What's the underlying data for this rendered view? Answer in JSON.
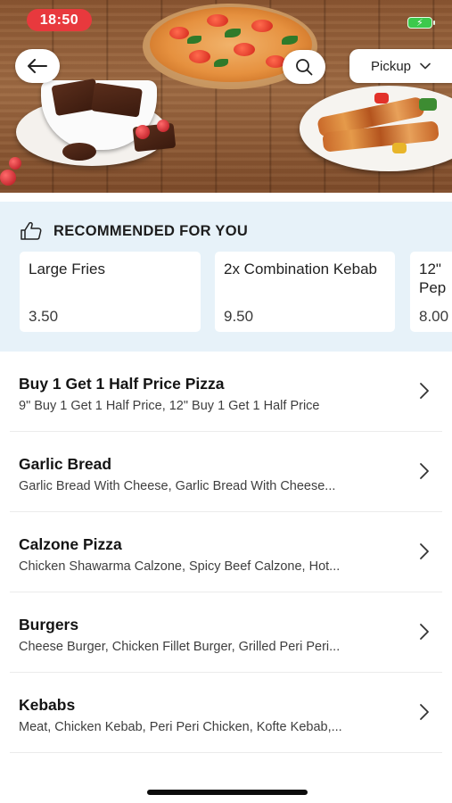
{
  "status_bar": {
    "time": "18:50",
    "battery_color": "#3cc94c",
    "time_pill_color": "#e8393d"
  },
  "header": {
    "back_icon": "arrow-left-icon",
    "search_icon": "search-icon",
    "order_mode": "Pickup",
    "order_mode_icon": "chevron-down-icon"
  },
  "recommended": {
    "heading": "RECOMMENDED FOR YOU",
    "icon": "thumbs-up-icon",
    "background": "#e7f2f9",
    "items": [
      {
        "name": "Large Fries",
        "price": "3.50"
      },
      {
        "name": "2x Combination Kebab",
        "price": "9.50"
      },
      {
        "name": "12\" Pep",
        "price": "8.00"
      }
    ]
  },
  "menu": {
    "categories": [
      {
        "title": "Buy 1 Get 1 Half Price Pizza",
        "subtitle": "9\" Buy 1 Get 1 Half Price, 12\" Buy 1 Get 1 Half Price"
      },
      {
        "title": "Garlic Bread",
        "subtitle": "Garlic Bread With Cheese, Garlic Bread With Cheese..."
      },
      {
        "title": "Calzone Pizza",
        "subtitle": "Chicken Shawarma Calzone, Spicy Beef Calzone, Hot..."
      },
      {
        "title": "Burgers",
        "subtitle": "Cheese Burger, Chicken Fillet Burger, Grilled Peri Peri..."
      },
      {
        "title": "Kebabs",
        "subtitle": "Meat, Chicken Kebab, Peri Peri Chicken, Kofte Kebab,..."
      }
    ],
    "row_icon": "chevron-right-icon"
  }
}
